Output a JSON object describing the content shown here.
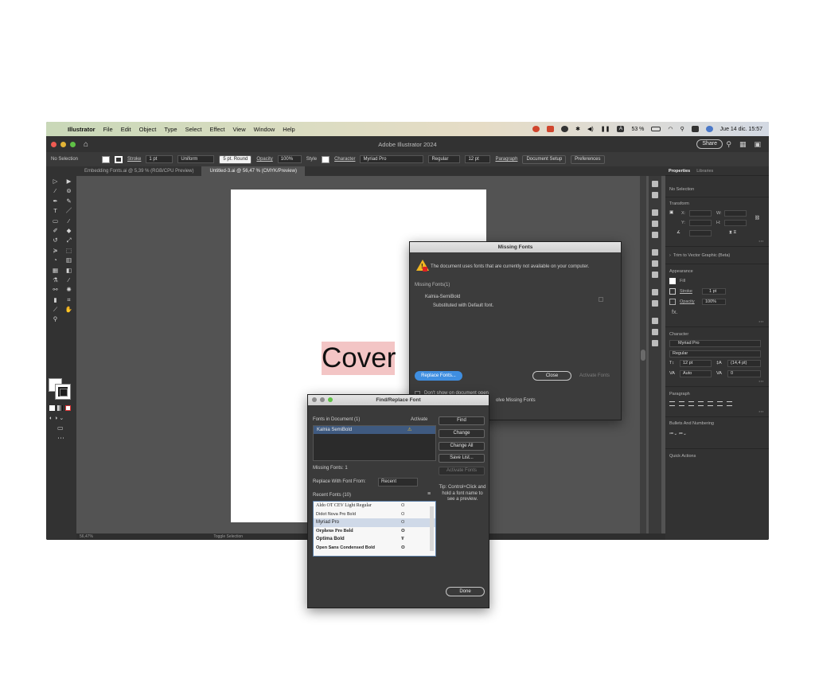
{
  "menubar": {
    "app": "Illustrator",
    "items": [
      "File",
      "Edit",
      "Object",
      "Type",
      "Select",
      "Effect",
      "View",
      "Window",
      "Help"
    ],
    "battery": "53 %",
    "datetime": "Jue 14 dic.  15:57",
    "a_badge": "A"
  },
  "window": {
    "title": "Adobe Illustrator 2024",
    "share_label": "Share"
  },
  "controlbar": {
    "selection": "No Selection",
    "stroke_label": "Stroke",
    "stroke_value": "1 pt",
    "profile": "Uniform",
    "brush": "5 pt. Round",
    "opacity_label": "Opacity",
    "opacity_value": "100%",
    "style_label": "Style",
    "character_label": "Character",
    "font": "Myriad Pro",
    "weight": "Regular",
    "size": "12 pt",
    "paragraph_label": "Paragraph",
    "doc_setup": "Document Setup",
    "preferences": "Preferences"
  },
  "tabs": [
    {
      "label": "Embedding Fonts.ai @ 5,39 % (RGB/CPU Preview)"
    },
    {
      "label": "Untitled-3.ai @ 56,47 % (CMYK/Preview)"
    }
  ],
  "artboard": {
    "cover_text": "Cover"
  },
  "statusbar": {
    "zoom": "56,47%",
    "mode": "Toggle Selection"
  },
  "properties": {
    "tab_properties": "Properties",
    "tab_libraries": "Libraries",
    "no_selection": "No Selection",
    "transform": "Transform",
    "x": "X:",
    "y": "Y:",
    "w": "W:",
    "h": "H:",
    "trim": "Trim to Vector Graphic (Beta)",
    "appearance": "Appearance",
    "fill": "Fill",
    "stroke": "Stroke",
    "stroke_value": "1 pt",
    "opacity": "Opacity",
    "opacity_value": "100%",
    "fx": "fx.",
    "character": "Character",
    "font": "Myriad Pro",
    "weight": "Regular",
    "size": "12 pt",
    "leading": "(14,4 pt)",
    "kerning": "Auto",
    "tracking": "0",
    "paragraph": "Paragraph",
    "bullets": "Bullets And Numbering",
    "quick_actions": "Quick Actions"
  },
  "missing_fonts": {
    "title": "Missing Fonts",
    "message": "The document uses fonts that are currently not available on your computer.",
    "header": "Missing Fonts(1)",
    "font_name": "Kalnia-SemiBold",
    "substituted": "Substituted with Default font.",
    "replace_btn": "Replace Fonts...",
    "close_btn": "Close",
    "activate_btn": "Activate Fonts",
    "dont_show": "Don't show on document open",
    "solve_partial": "olve Missing Fonts"
  },
  "find_replace": {
    "title": "Find/Replace Font",
    "fonts_in_doc": "Fonts in Document (1)",
    "activate_col": "Activate",
    "doc_fonts": [
      "Kalnia SemiBold"
    ],
    "missing_count": "Missing Fonts: 1",
    "replace_with": "Replace With Font From:",
    "replace_source": "Recent",
    "recent_header": "Recent Fonts (10)",
    "recent_fonts": [
      "Aldo OT CEV Light Regular",
      "Didot Nova Pro Bold",
      "Myriad Pro",
      "Orpheus Pro Bold",
      "Optima Bold",
      "Open Sans Condensed Bold"
    ],
    "btn_find": "Find",
    "btn_change": "Change",
    "btn_change_all": "Change All",
    "btn_save": "Save List...",
    "btn_activate": "Activate Fonts",
    "tip": "Tip: Control+Click and hold a font name to see a preview.",
    "btn_done": "Done"
  }
}
